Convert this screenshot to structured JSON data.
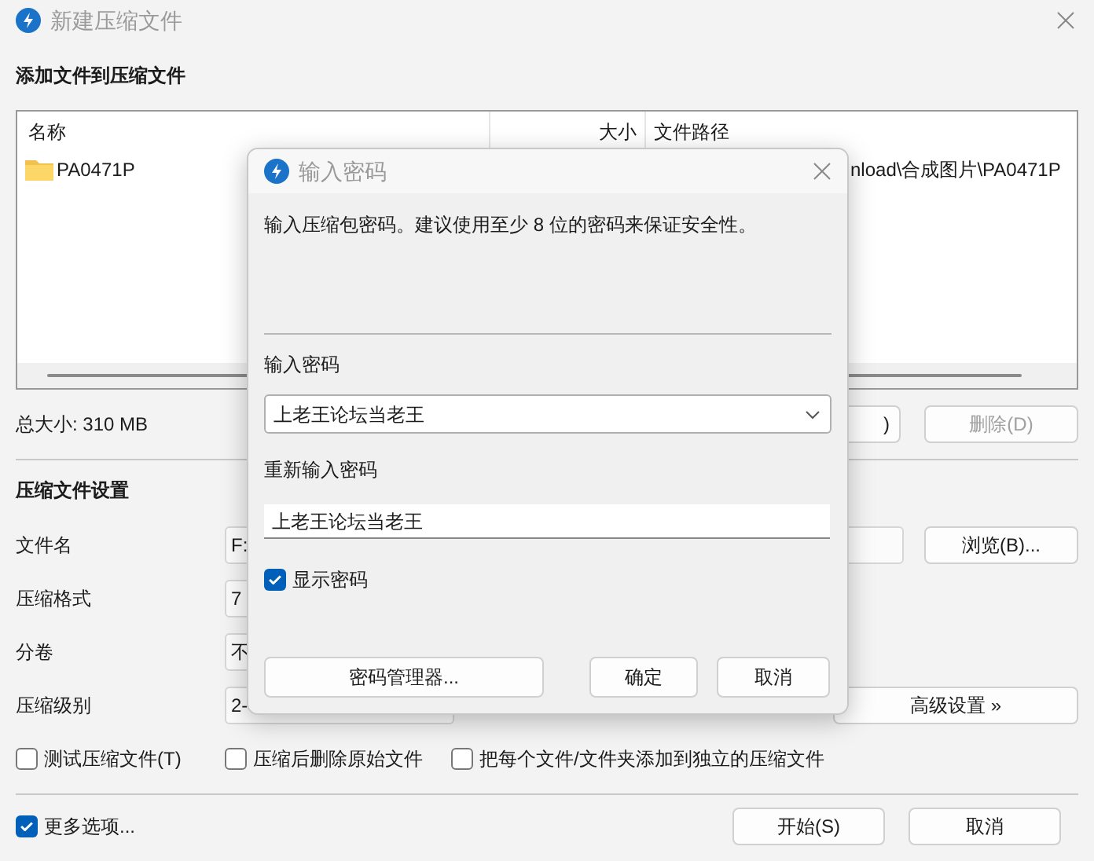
{
  "window": {
    "title": "新建压缩文件"
  },
  "files": {
    "heading": "添加文件到压缩文件",
    "columns": [
      "名称",
      "大小",
      "文件路径"
    ],
    "rows": [
      {
        "name": "PA0471P",
        "path": "nload\\合成图片\\PA0471P"
      }
    ],
    "total": "总大小: 310 MB",
    "buttons": [
      {
        "label": ")",
        "disabled": false
      },
      {
        "label": "删除(D)",
        "disabled": true
      }
    ]
  },
  "settings": {
    "heading": "压缩文件设置",
    "fields": [
      {
        "label": "文件名",
        "value": "F:"
      },
      {
        "label": "压缩格式",
        "value": "7"
      },
      {
        "label": "分卷",
        "value": "不"
      },
      {
        "label": "压缩级别",
        "value": "2-"
      }
    ],
    "browse": "浏览(B)...",
    "advanced": "高级设置 »",
    "options": [
      {
        "label": "测试压缩文件(T)",
        "checked": false
      },
      {
        "label": "压缩后删除原始文件",
        "checked": false
      },
      {
        "label": "把每个文件/文件夹添加到独立的压缩文件",
        "checked": false
      }
    ]
  },
  "footer": {
    "more_options": {
      "label": "更多选项...",
      "checked": true
    },
    "buttons": [
      "开始(S)",
      "取消"
    ]
  },
  "dialog": {
    "title": "输入密码",
    "message": "输入压缩包密码。建议使用至少 8 位的密码来保证安全性。",
    "password_label": "输入密码",
    "password": "上老王论坛当老王",
    "confirm_label": "重新输入密码",
    "confirm": "上老王论坛当老王",
    "show_password": {
      "label": "显示密码",
      "checked": true
    },
    "buttons": [
      "密码管理器...",
      "确定",
      "取消"
    ]
  }
}
